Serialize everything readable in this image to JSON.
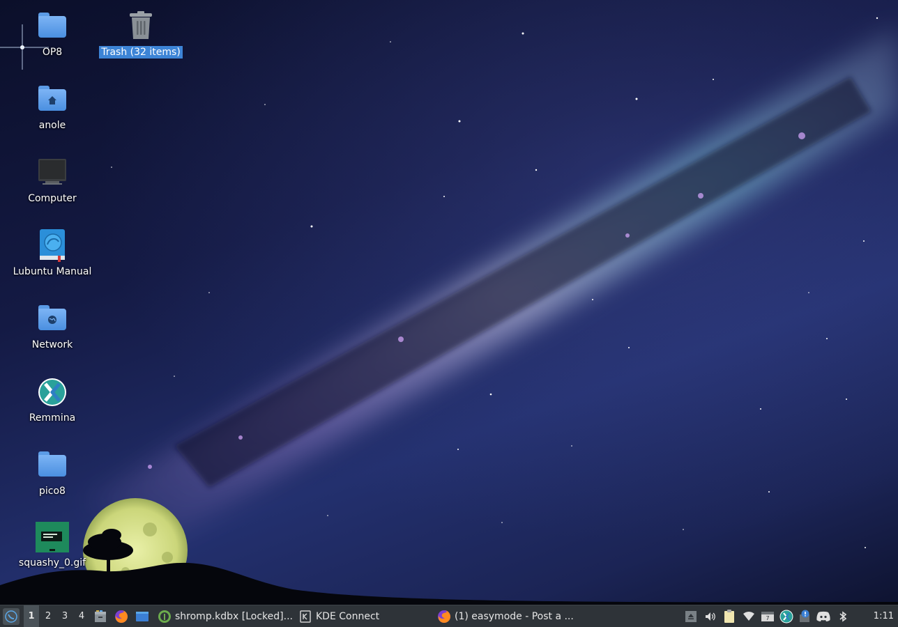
{
  "desktop": {
    "icons": [
      {
        "label": "OP8",
        "icon": "folder-icon"
      },
      {
        "label": "Trash (32 items)",
        "icon": "trash-icon",
        "selected": true
      },
      {
        "label": "anole",
        "icon": "home-folder-icon"
      },
      {
        "label": "Computer",
        "icon": "computer-icon"
      },
      {
        "label": "Lubuntu Manual",
        "icon": "manual-book-icon"
      },
      {
        "label": "Network",
        "icon": "network-folder-icon"
      },
      {
        "label": "Remmina",
        "icon": "remmina-icon"
      },
      {
        "label": "pico8",
        "icon": "folder-icon"
      },
      {
        "label": "squashy_0.gif",
        "icon": "image-thumbnail-icon"
      }
    ]
  },
  "taskbar": {
    "menu_icon": "lubuntu-menu-icon",
    "workspaces": [
      "1",
      "2",
      "3",
      "4"
    ],
    "active_workspace": "1",
    "launchers": [
      {
        "name": "file-manager-icon"
      },
      {
        "name": "firefox-icon"
      },
      {
        "name": "show-desktop-icon"
      }
    ],
    "tasks": [
      {
        "label": "shromp.kdbx [Locked]...",
        "icon": "keepassxc-icon"
      },
      {
        "label": "KDE Connect",
        "icon": "kde-connect-icon"
      },
      {
        "label": "(1) easymode - Post a ...",
        "icon": "firefox-icon"
      }
    ],
    "tray": [
      "eject-icon",
      "volume-icon",
      "clipboard-icon",
      "wifi-icon",
      "calendar-icon",
      "remmina-tray-icon",
      "update-notifier-icon",
      "discord-icon",
      "bluetooth-icon"
    ],
    "calendar_day": "7",
    "clock": "1:11"
  },
  "colors": {
    "selection": "#3d84d6",
    "folder": "#5b9be6",
    "taskbar": "#2e3338"
  }
}
